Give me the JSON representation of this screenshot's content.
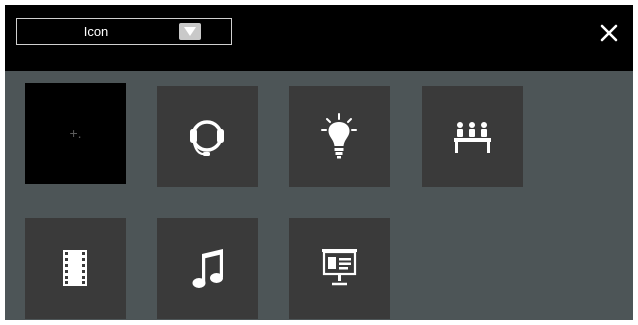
{
  "header": {
    "dropdown": {
      "value": "Icon",
      "arrow_icon": "triangle-down-icon"
    },
    "close_icon": "close-icon"
  },
  "grid": {
    "add_tile": {
      "label": "+.",
      "icon": "add-icon"
    },
    "icons": [
      "headset-icon",
      "lightbulb-icon",
      "audience-icon",
      "film-icon",
      "music-note-icon",
      "presentation-icon"
    ]
  },
  "colors": {
    "background": "#4d5557",
    "header": "#000000",
    "tile": "#3a3a3a",
    "icon": "#ffffff"
  }
}
